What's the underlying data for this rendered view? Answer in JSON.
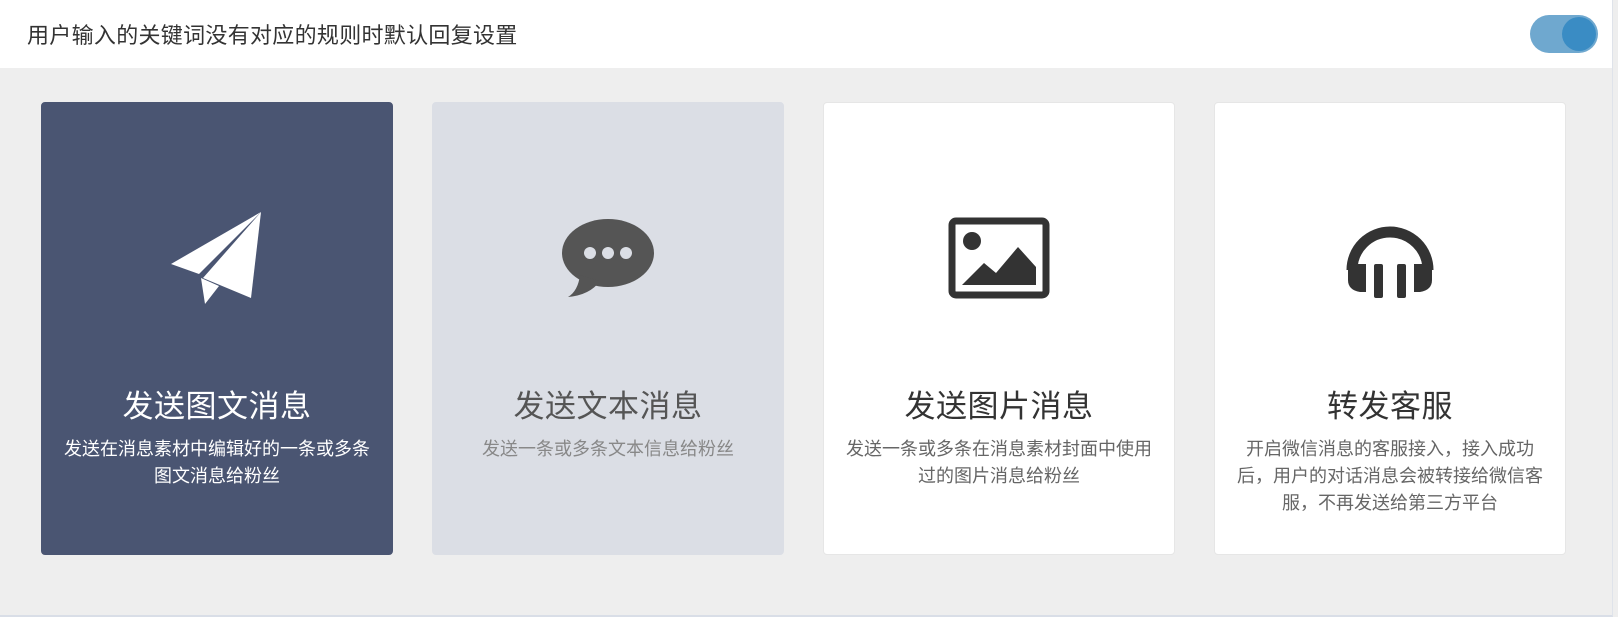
{
  "header": {
    "title": "用户输入的关键词没有对应的规则时默认回复设置",
    "toggle_state": "on"
  },
  "colors": {
    "active_card": "#4a5572",
    "hover_card": "#dbdee5",
    "toggle_track": "#6fa8cf",
    "toggle_knob": "#3a8cc4"
  },
  "cards": [
    {
      "icon": "paper-plane-icon",
      "title": "发送图文消息",
      "desc": "发送在消息素材中编辑好的一条或多条图文消息给粉丝",
      "state": "selected"
    },
    {
      "icon": "speech-bubble-icon",
      "title": "发送文本消息",
      "desc": "发送一条或多条文本信息给粉丝",
      "state": "hover"
    },
    {
      "icon": "image-icon",
      "title": "发送图片消息",
      "desc": "发送一条或多条在消息素材封面中使用过的图片消息给粉丝",
      "state": "default"
    },
    {
      "icon": "headphones-icon",
      "title": "转发客服",
      "desc": "开启微信消息的客服接入，接入成功后，用户的对话消息会被转接给微信客服，不再发送给第三方平台",
      "state": "default"
    }
  ]
}
